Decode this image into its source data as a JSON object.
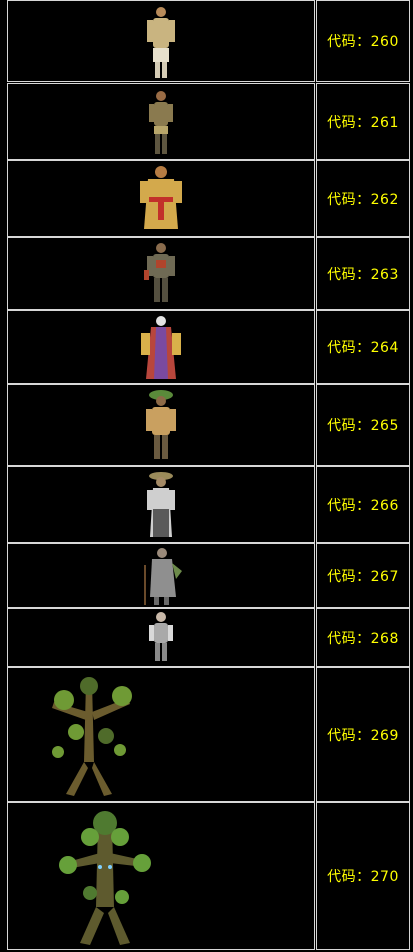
{
  "rows": [
    {
      "code": "代码：260",
      "figure": "human-figure-tan-robe-icon",
      "palette": {
        "body": "#c9b480",
        "accent": "#e7e0cc",
        "head": "#b88b5a"
      }
    },
    {
      "code": "代码：261",
      "figure": "human-figure-dark-tunic-icon",
      "palette": {
        "body": "#8a7a4f",
        "accent": "#b8a66a",
        "head": "#9a6c45"
      }
    },
    {
      "code": "代码：262",
      "figure": "human-figure-gold-robe-icon",
      "palette": {
        "body": "#d3a94c",
        "accent": "#c2302a",
        "head": "#b67c43"
      }
    },
    {
      "code": "代码：263",
      "figure": "human-figure-armored-icon",
      "palette": {
        "body": "#6f6a54",
        "accent": "#b0442c",
        "head": "#8a6c4d"
      }
    },
    {
      "code": "代码：264",
      "figure": "human-figure-red-robe-icon",
      "palette": {
        "body": "#b8463c",
        "accent": "#d9b14a",
        "head": "#e2e2e2"
      }
    },
    {
      "code": "代码：265",
      "figure": "human-figure-leaf-hat-icon",
      "palette": {
        "body": "#c9a060",
        "accent": "#5a8a3a",
        "head": "#8d6a47"
      }
    },
    {
      "code": "代码：266",
      "figure": "human-figure-white-robe-icon",
      "palette": {
        "body": "#cfcfcf",
        "accent": "#5a5a5a",
        "head": "#a48a66"
      }
    },
    {
      "code": "代码：267",
      "figure": "human-figure-elder-cane-icon",
      "palette": {
        "body": "#8f8f8f",
        "accent": "#6c8a4a",
        "head": "#9a8a7a"
      }
    },
    {
      "code": "代码：268",
      "figure": "human-figure-small-white-icon",
      "palette": {
        "body": "#a9a9a9",
        "accent": "#d9d9d9",
        "head": "#c9b9a9"
      }
    },
    {
      "code": "代码：269",
      "figure": "treant-figure-icon",
      "palette": {
        "body": "#6b5c2e",
        "accent": "#6f9a35",
        "head": "#4f6b2a"
      }
    },
    {
      "code": "代码：270",
      "figure": "treant-figure-large-icon",
      "palette": {
        "body": "#5e5a2e",
        "accent": "#66a03a",
        "head": "#4f7a30"
      }
    }
  ]
}
